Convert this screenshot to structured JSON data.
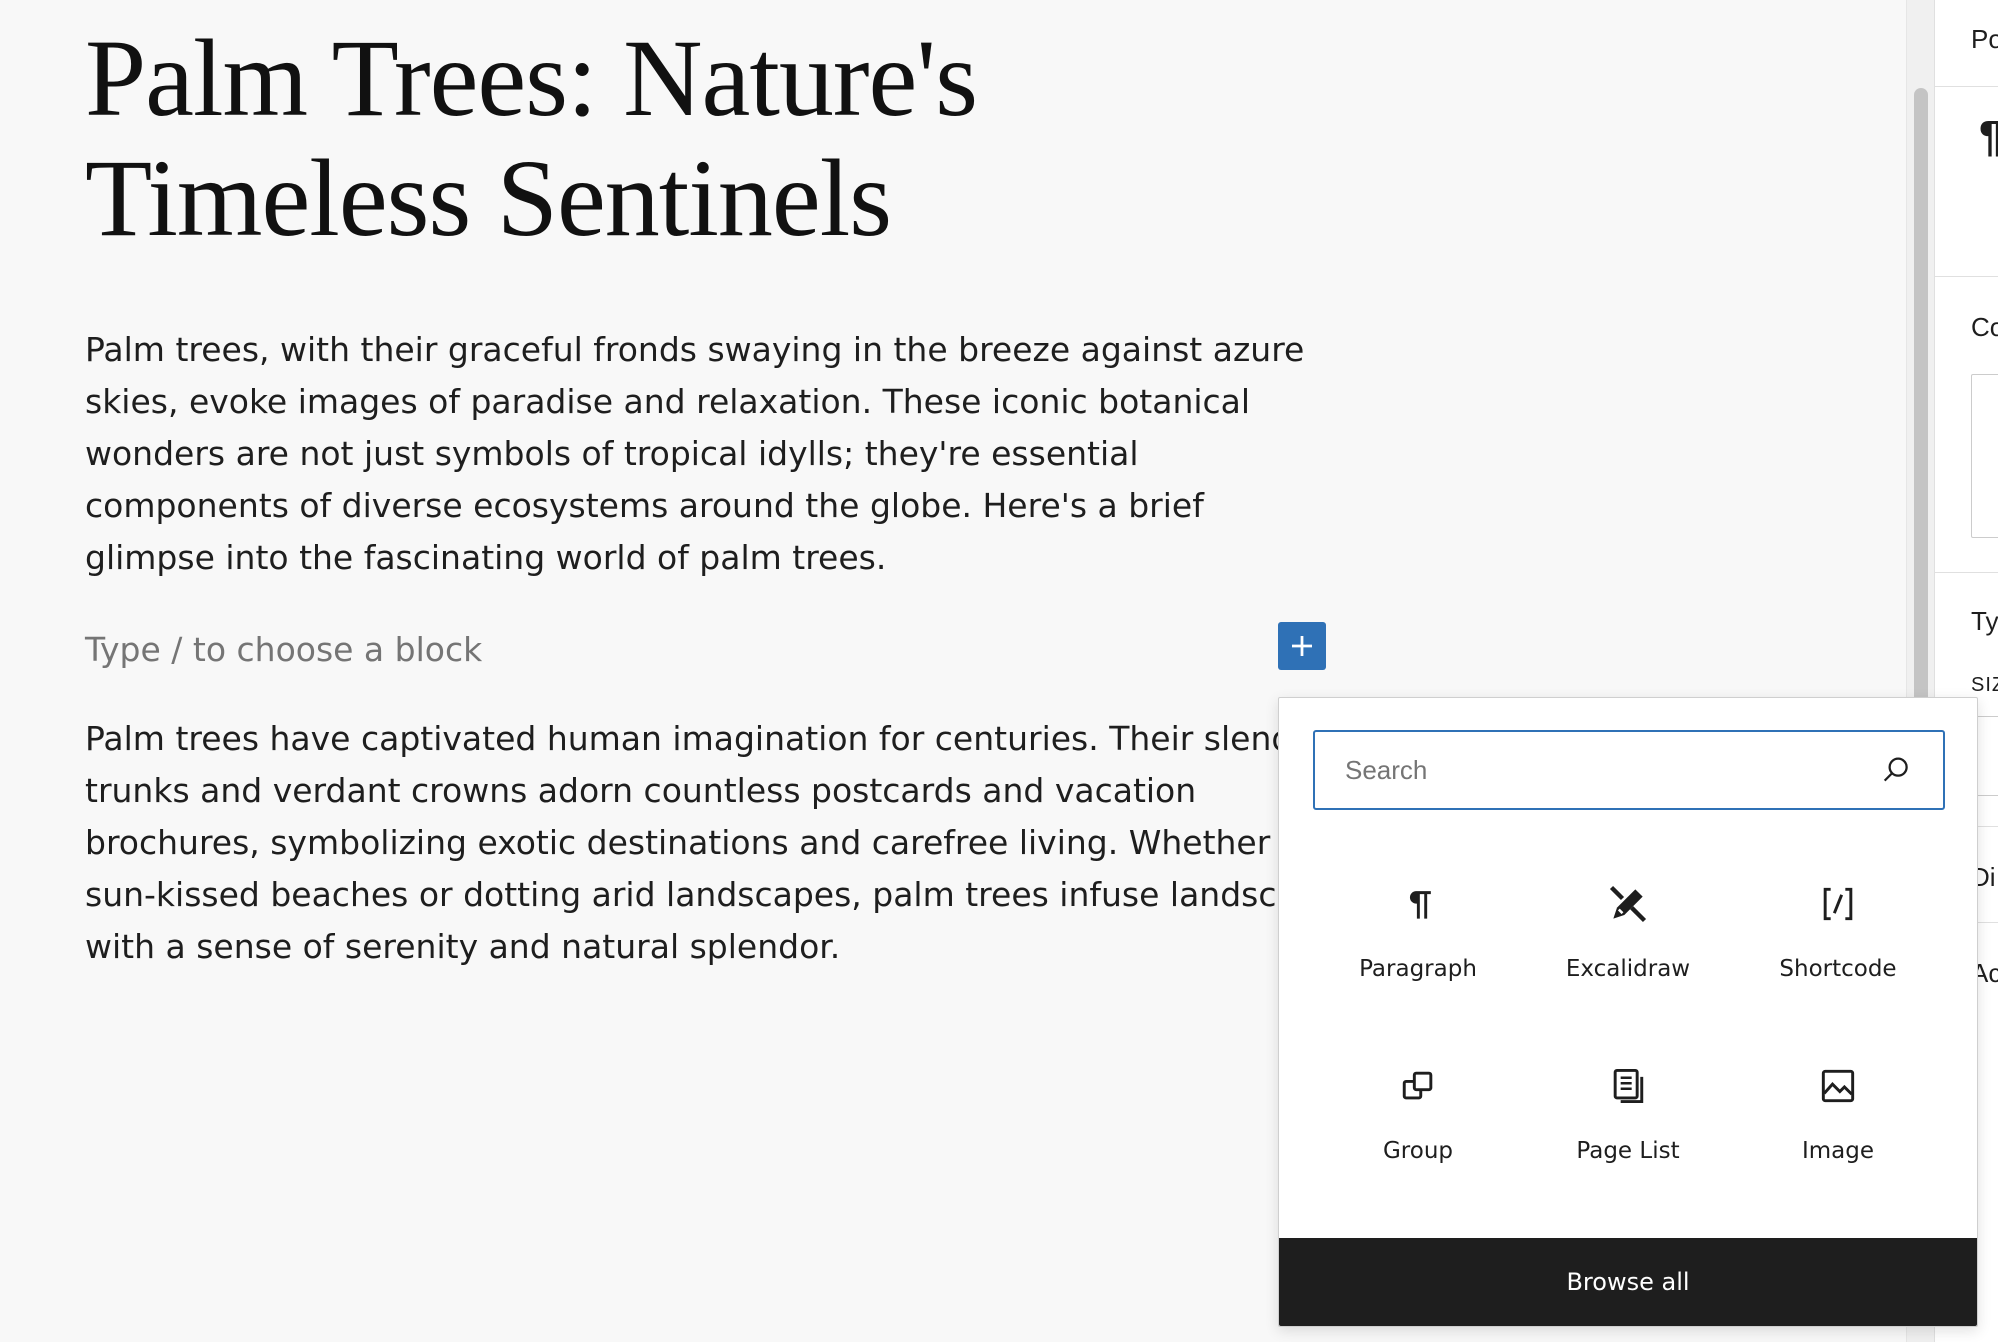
{
  "post": {
    "title_line1": "Palm Trees: Nature's",
    "title_line2": "Timeless Sentinels",
    "paragraph1": "Palm trees, with their graceful fronds swaying in the breeze against azure skies, evoke images of paradise and relaxation. These iconic botanical wonders are not just symbols of tropical idylls; they're essential components of diverse ecosystems around the globe. Here's a brief glimpse into the fascinating world of palm trees.",
    "placeholder": "Type / to choose a block",
    "paragraph2_lines": [
      "Palm trees have captivated human imagination for centuries. Their slender",
      "trunks and verdant crowns adorn countless postcards and vacation",
      "brochures, symbolizing exotic destinations and carefree living. Whether linir",
      "sun-kissed beaches or dotting arid landscapes, palm trees infuse landscape",
      "with a sense of serenity and natural splendor."
    ]
  },
  "inserter": {
    "toggle_icon": "plus-icon",
    "search_placeholder": "Search",
    "blocks": [
      {
        "label": "Paragraph",
        "icon": "paragraph-icon"
      },
      {
        "label": "Excalidraw",
        "icon": "excalidraw-icon"
      },
      {
        "label": "Shortcode",
        "icon": "shortcode-icon"
      },
      {
        "label": "Group",
        "icon": "group-icon"
      },
      {
        "label": "Page List",
        "icon": "page-list-icon"
      },
      {
        "label": "Image",
        "icon": "image-icon"
      }
    ],
    "browse_all_label": "Browse all"
  },
  "sidebar": {
    "tab_partial": "Po",
    "pilcrow": "¶",
    "color_partial": "Co",
    "typography_partial": "Ty",
    "size_partial": "SIZ",
    "dimensions_partial": "Di",
    "advanced_partial": "Ac"
  },
  "colors": {
    "accent": "#2f71b6",
    "browse_bg": "#1e1e1e",
    "placeholder_text": "#757575"
  }
}
